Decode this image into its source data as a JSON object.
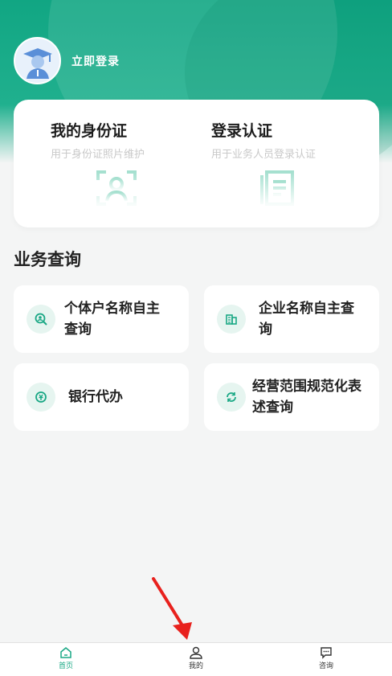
{
  "colors": {
    "brand": "#11a683",
    "card": "#ffffff",
    "bg": "#f4f5f5"
  },
  "header": {
    "login_label": "立即登录",
    "avatar_icon": "graduate-avatar-icon"
  },
  "identity": [
    {
      "title": "我的身份证",
      "subtitle": "用于身份证照片维护",
      "icon": "id-scan-icon"
    },
    {
      "title": "登录认证",
      "subtitle": "用于业务人员登录认证",
      "icon": "document-icon"
    }
  ],
  "business": {
    "title": "业务查询",
    "tiles": [
      {
        "label_line1": "个体户名称自主",
        "label_line2": "查询",
        "icon": "search-person-icon"
      },
      {
        "label_line1": "企业名称自主查",
        "label_line2": "询",
        "icon": "building-icon"
      },
      {
        "label_line1": "银行代办",
        "label_line2": "",
        "icon": "bank-icon"
      },
      {
        "label_line1": "经营范围规范化表",
        "label_line2": "述查询",
        "icon": "refresh-icon"
      }
    ]
  },
  "nav": {
    "items": [
      {
        "label": "首页",
        "icon": "home-icon",
        "active": true
      },
      {
        "label": "我的",
        "icon": "user-icon",
        "active": false
      },
      {
        "label": "咨询",
        "icon": "chat-icon",
        "active": false
      }
    ]
  }
}
